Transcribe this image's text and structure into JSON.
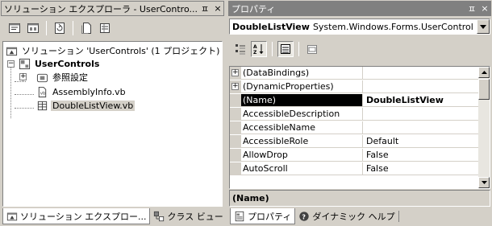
{
  "solution_explorer": {
    "title": "ソリューション エクスプローラ - UserContro...",
    "pin_glyph": "ㅍ",
    "close_glyph": "×",
    "toolbar_icons": [
      "view-code-icon",
      "view-designer-icon",
      "refresh-icon",
      "show-all-files-icon",
      "properties-icon"
    ],
    "tree": {
      "solution": "ソリューション 'UserControls' (1 プロジェクト)",
      "project": "UserControls",
      "references": "参照設定",
      "files": [
        "AssemblyInfo.vb",
        "DoubleListView.vb"
      ]
    },
    "tabs": [
      "ソリューション エクスプロー...",
      "クラス ビュー"
    ]
  },
  "properties": {
    "title": "プロパティ",
    "pin_glyph": "ㅍ",
    "close_glyph": "×",
    "object_name": "DoubleListView",
    "object_type": "System.Windows.Forms.UserControl",
    "toolbar_icons": [
      "categorized-icon",
      "alphabetical-icon",
      "properties-icon",
      "property-pages-icon"
    ],
    "rows": [
      {
        "name": "(DataBindings)",
        "value": "",
        "expandable": true
      },
      {
        "name": "(DynamicProperties)",
        "value": "",
        "expandable": true
      },
      {
        "name": "(Name)",
        "value": "DoubleListView",
        "selected": true
      },
      {
        "name": "AccessibleDescription",
        "value": ""
      },
      {
        "name": "AccessibleName",
        "value": ""
      },
      {
        "name": "AccessibleRole",
        "value": "Default"
      },
      {
        "name": "AllowDrop",
        "value": "False"
      },
      {
        "name": "AutoScroll",
        "value": "False"
      }
    ],
    "description_title": "(Name)",
    "tabs": [
      "プロパティ",
      "ダイナミック ヘルプ"
    ]
  }
}
